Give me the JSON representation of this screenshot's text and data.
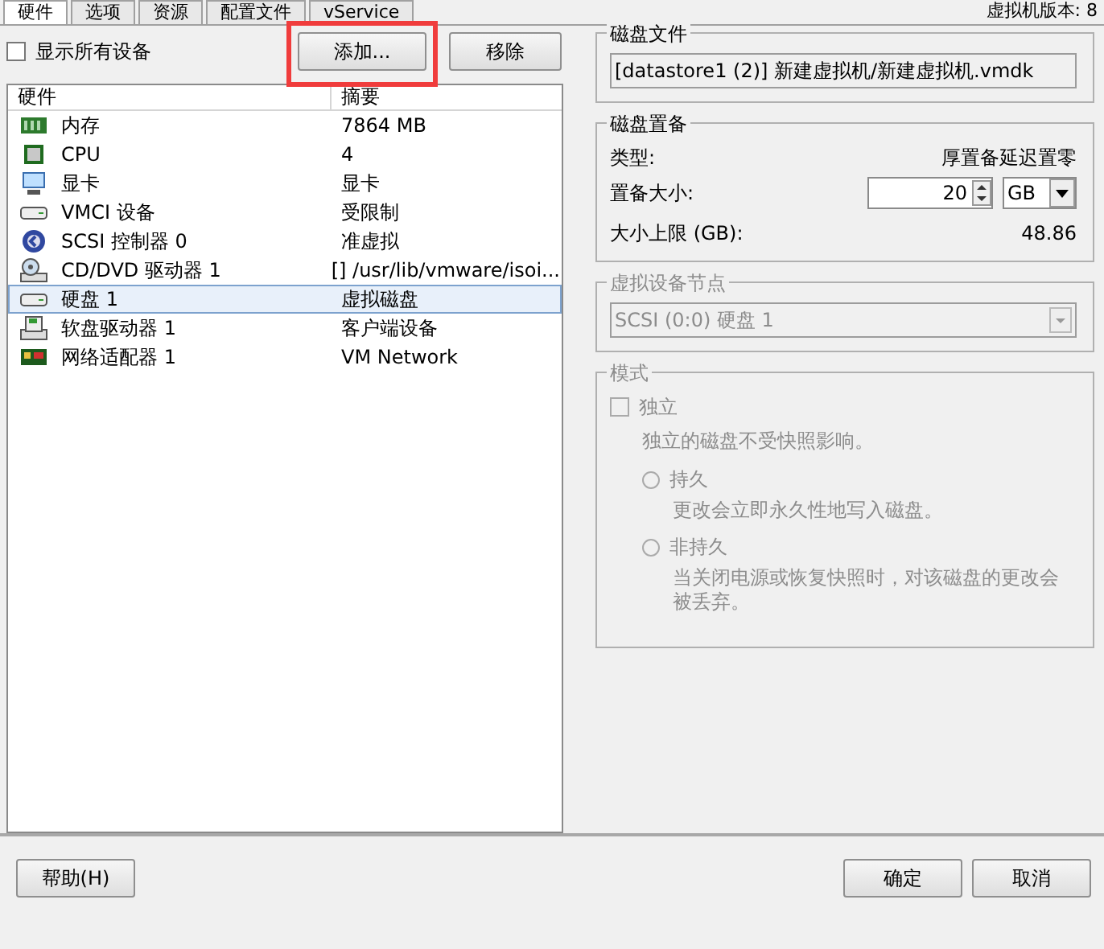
{
  "tabs": [
    {
      "label": "硬件",
      "selected": true
    },
    {
      "label": "选项",
      "selected": false
    },
    {
      "label": "资源",
      "selected": false
    },
    {
      "label": "配置文件",
      "selected": false
    },
    {
      "label": "vService",
      "selected": false
    }
  ],
  "version_label": "虚拟机版本: 8",
  "show_all_devices": {
    "label": "显示所有设备",
    "checked": false
  },
  "buttons": [
    {
      "label": "添加...",
      "highlighted": true
    },
    {
      "label": "移除",
      "highlighted": false
    }
  ],
  "hardware_table": {
    "columns": [
      "硬件",
      "摘要"
    ],
    "rows": [
      {
        "kind": "memory",
        "name": "内存",
        "summary": "7864 MB",
        "selected": false
      },
      {
        "kind": "cpu",
        "name": "CPU",
        "summary": "4",
        "selected": false
      },
      {
        "kind": "monitor",
        "name": "显卡",
        "summary": "显卡",
        "selected": false
      },
      {
        "kind": "drive",
        "name": "VMCI 设备",
        "summary": "受限制",
        "selected": false
      },
      {
        "kind": "controller",
        "name": "SCSI 控制器 0",
        "summary": "准虚拟",
        "selected": false
      },
      {
        "kind": "cdrom",
        "name": "CD/DVD 驱动器 1",
        "summary": "[] /usr/lib/vmware/isoi...",
        "selected": false
      },
      {
        "kind": "drive",
        "name": "硬盘 1",
        "summary": "虚拟磁盘",
        "selected": true
      },
      {
        "kind": "floppy",
        "name": "软盘驱动器 1",
        "summary": "客户端设备",
        "selected": false
      },
      {
        "kind": "network",
        "name": "网络适配器 1",
        "summary": "VM Network",
        "selected": false
      }
    ]
  },
  "disk_file": {
    "title": "磁盘文件",
    "value": "[datastore1 (2)] 新建虚拟机/新建虚拟机.vmdk"
  },
  "provisioning": {
    "title": "磁盘置备",
    "type_label": "类型:",
    "type_value": "厚置备延迟置零",
    "size_label": "置备大小:",
    "size_value": "20",
    "unit": "GB",
    "max_label": "大小上限 (GB):",
    "max_value": "48.86"
  },
  "device_node": {
    "title": "虚拟设备节点",
    "value": "SCSI (0:0) 硬盘 1",
    "disabled": true
  },
  "mode": {
    "title": "模式",
    "disabled": true,
    "independent": {
      "label": "独立",
      "checked": false,
      "description": "独立的磁盘不受快照影响。"
    },
    "options": [
      {
        "label": "持久",
        "description": "更改会立即永久性地写入磁盘。",
        "selected": false
      },
      {
        "label": "非持久",
        "description": "当关闭电源或恢复快照时，对该磁盘的更改会被丢弃。",
        "selected": false
      }
    ]
  },
  "footer_buttons": [
    {
      "label": "帮助(H)"
    },
    {
      "label": "确定"
    },
    {
      "label": "取消"
    }
  ]
}
